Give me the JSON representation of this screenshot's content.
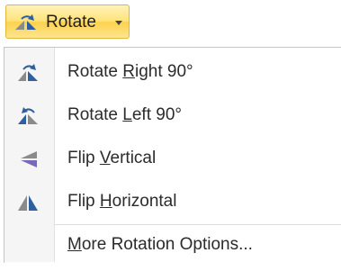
{
  "button": {
    "label": "Rotate",
    "icon": "rotate-icon"
  },
  "menu": {
    "items": [
      {
        "pre": "Rotate ",
        "key": "R",
        "post": "ight 90°",
        "icon": "rotate-right-icon"
      },
      {
        "pre": "Rotate ",
        "key": "L",
        "post": "eft 90°",
        "icon": "rotate-left-icon"
      },
      {
        "pre": "Flip ",
        "key": "V",
        "post": "ertical",
        "icon": "flip-vertical-icon"
      },
      {
        "pre": "Flip ",
        "key": "H",
        "post": "orizontal",
        "icon": "flip-horizontal-icon"
      }
    ],
    "more": {
      "pre": "",
      "key": "M",
      "post": "ore Rotation Options..."
    }
  },
  "colors": {
    "icon_blue": "#2f5f9e",
    "icon_gray": "#8a8a8a",
    "button_border": "#e3b53a"
  }
}
